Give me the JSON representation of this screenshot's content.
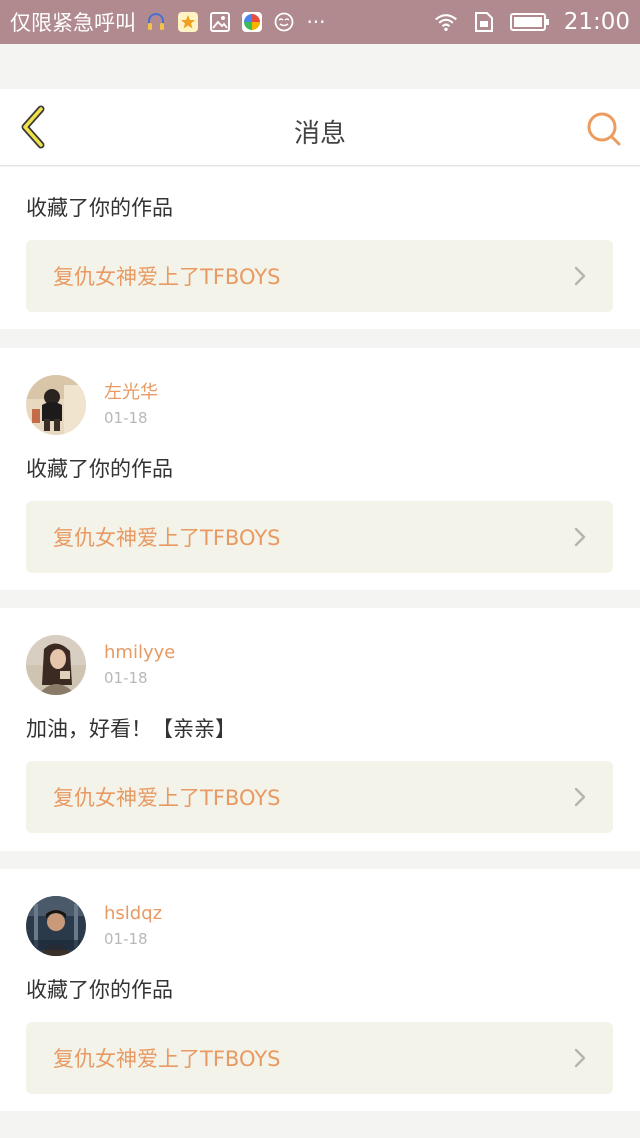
{
  "status_bar": {
    "carrier": "仅限紧急呼叫",
    "time": "21:00",
    "icons": [
      "headset-icon",
      "star-app-icon",
      "image-icon",
      "colorful-app-icon",
      "face-icon",
      "more-dots-icon",
      "wifi-icon",
      "sim-icon",
      "battery-icon"
    ],
    "more": "···"
  },
  "header": {
    "title": "消息",
    "accent_color": "#e89a62",
    "back_icon": "chevron-left-icon",
    "search_icon": "search-icon"
  },
  "messages": [
    {
      "has_user": false,
      "text": "收藏了你的作品",
      "work": "复仇女神爱上了TFBOYS"
    },
    {
      "has_user": true,
      "username": "左光华",
      "date": "01-18",
      "text": "收藏了你的作品",
      "work": "复仇女神爱上了TFBOYS"
    },
    {
      "has_user": true,
      "username": "hmilyye",
      "date": "01-18",
      "text": "加油，好看！【亲亲】",
      "work": "复仇女神爱上了TFBOYS"
    },
    {
      "has_user": true,
      "username": "hsldqz",
      "date": "01-18",
      "text": "收藏了你的作品",
      "work": "复仇女神爱上了TFBOYS"
    }
  ]
}
